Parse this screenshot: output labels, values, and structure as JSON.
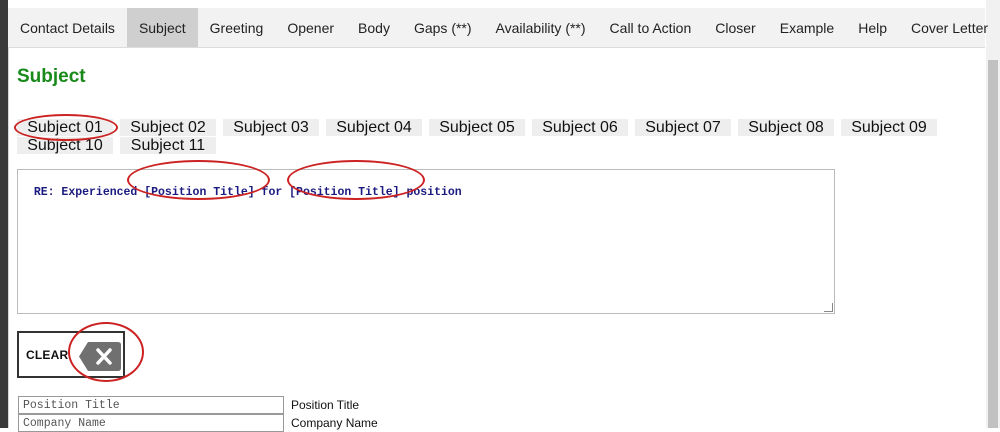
{
  "nav": {
    "tabs": [
      {
        "label": "Contact Details",
        "active": false
      },
      {
        "label": "Subject",
        "active": true
      },
      {
        "label": "Greeting",
        "active": false
      },
      {
        "label": "Opener",
        "active": false
      },
      {
        "label": "Body",
        "active": false
      },
      {
        "label": "Gaps (**)",
        "active": false
      },
      {
        "label": "Availability (**)",
        "active": false
      },
      {
        "label": "Call to Action",
        "active": false
      },
      {
        "label": "Closer",
        "active": false
      },
      {
        "label": "Example",
        "active": false
      },
      {
        "label": "Help",
        "active": false
      },
      {
        "label": "Cover Letter",
        "active": false
      }
    ]
  },
  "page": {
    "title": "Subject"
  },
  "subject_tabs": {
    "row1": [
      "Subject 01",
      "Subject 02",
      "Subject 03",
      "Subject 04",
      "Subject 05",
      "Subject 06",
      "Subject 07",
      "Subject 08",
      "Subject 09"
    ],
    "row2": [
      "Subject 10",
      "Subject 11"
    ]
  },
  "editor": {
    "text": "RE: Experienced [Position Title] for [Position Title] position"
  },
  "clear_button": {
    "label": "CLEAR",
    "icon": "backspace-x-icon"
  },
  "fields": [
    {
      "placeholder": "Position Title",
      "label": "Position Title"
    },
    {
      "placeholder": "Company Name",
      "label": "Company Name"
    }
  ],
  "colors": {
    "title": "#1a8a1a",
    "annotation": "#cc2222",
    "active_tab": "#cfcfcf",
    "editor_text": "#1a1a80"
  }
}
